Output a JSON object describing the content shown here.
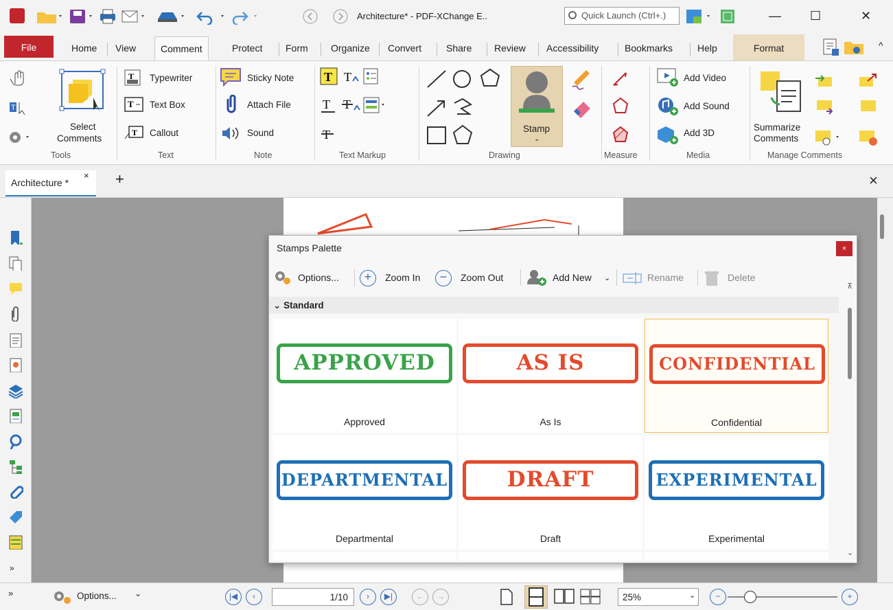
{
  "window": {
    "title": "Architecture* - PDF-XChange E..",
    "quick_launch_placeholder": "Quick Launch (Ctrl+.)",
    "min": "—",
    "max": "☐",
    "close": "✕"
  },
  "menu": {
    "file": "File",
    "tabs": [
      "Home",
      "View",
      "Comment",
      "Protect",
      "Form",
      "Organize",
      "Convert",
      "Share",
      "Review",
      "Accessibility",
      "Bookmarks",
      "Help"
    ],
    "active": "Comment",
    "format": "Format"
  },
  "ribbon": {
    "tools": {
      "label": "Tools",
      "select_comments_1": "Select",
      "select_comments_2": "Comments"
    },
    "text": {
      "label": "Text",
      "typewriter": "Typewriter",
      "text_box": "Text Box",
      "callout": "Callout"
    },
    "note": {
      "label": "Note",
      "sticky_note": "Sticky Note",
      "attach_file": "Attach File",
      "sound": "Sound"
    },
    "text_markup": {
      "label": "Text Markup"
    },
    "drawing": {
      "label": "Drawing",
      "stamp": "Stamp"
    },
    "measure": {
      "label": "Measure"
    },
    "media": {
      "label": "Media",
      "add_video": "Add Video",
      "add_sound": "Add Sound",
      "add_3d": "Add 3D"
    },
    "manage": {
      "label": "Manage Comments",
      "summarize_1": "Summarize",
      "summarize_2": "Comments"
    }
  },
  "doc_tab": {
    "name": "Architecture *",
    "close": "×",
    "add": "+",
    "close_all": "×"
  },
  "palette": {
    "title": "Stamps Palette",
    "close": "×",
    "toolbar": {
      "options": "Options...",
      "zoom_in": "Zoom In",
      "zoom_out": "Zoom Out",
      "add_new": "Add New",
      "rename": "Rename",
      "delete": "Delete"
    },
    "section": "Standard",
    "stamps": [
      {
        "text": "APPROVED",
        "label": "Approved",
        "color": "#3aa34a"
      },
      {
        "text": "AS IS",
        "label": "As Is",
        "color": "#e34b2d"
      },
      {
        "text": "CONFIDENTIAL",
        "label": "Confidential",
        "color": "#e34b2d"
      },
      {
        "text": "DEPARTMENTAL",
        "label": "Departmental",
        "color": "#1e6fb5"
      },
      {
        "text": "DRAFT",
        "label": "Draft",
        "color": "#e34b2d"
      },
      {
        "text": "EXPERIMENTAL",
        "label": "Experimental",
        "color": "#1e6fb5"
      }
    ]
  },
  "statusbar": {
    "options": "Options...",
    "page": "1/10",
    "zoom": "25%"
  }
}
